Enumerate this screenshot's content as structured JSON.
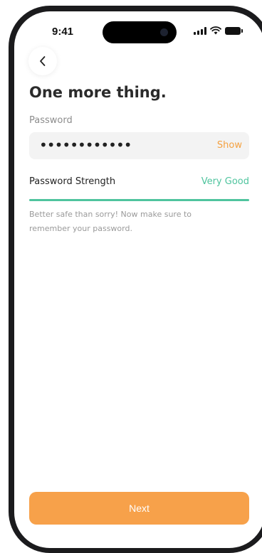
{
  "status_bar": {
    "time": "9:41",
    "icons": [
      "signal-icon",
      "wifi-icon",
      "battery-icon"
    ]
  },
  "header": {
    "back_icon": "chevron-left-icon",
    "title": "One more thing."
  },
  "password": {
    "label": "Password",
    "value": "••••••••••••",
    "show_label": "Show"
  },
  "strength": {
    "label": "Password Strength",
    "value": "Very Good",
    "level_fraction": 1.0,
    "color": "#4fc49e"
  },
  "hint": "Better safe than sorry! Now make sure to remember your password.",
  "footer": {
    "next_label": "Next",
    "button_color": "#f7a14a"
  },
  "colors": {
    "accent_orange": "#f4a140",
    "success_green": "#4fc49e"
  }
}
